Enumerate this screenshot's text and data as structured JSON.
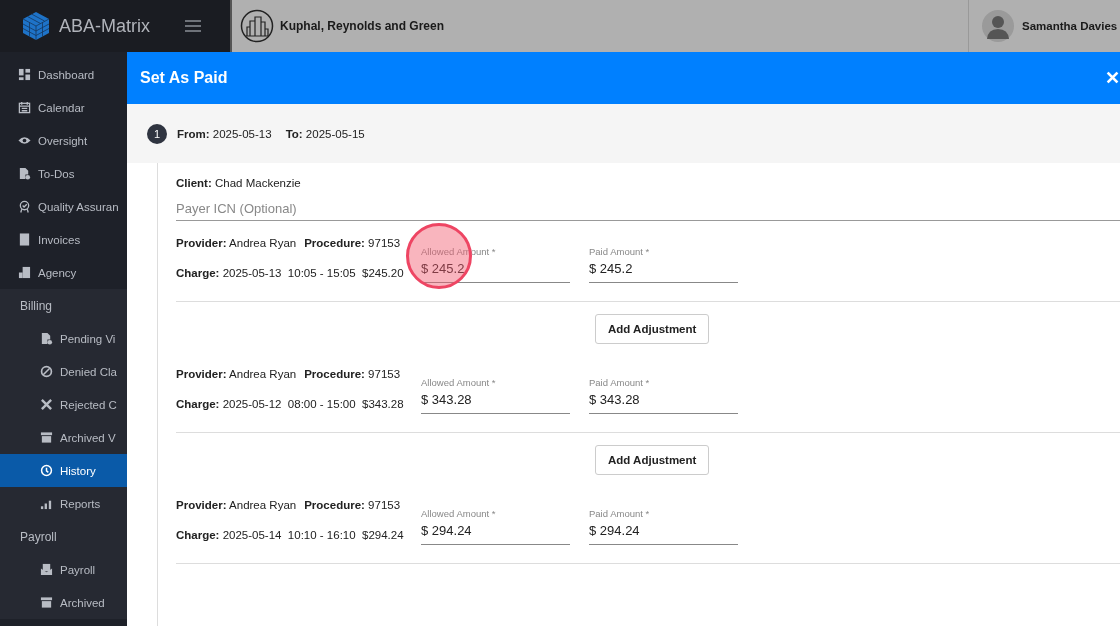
{
  "brand": {
    "name": "ABA-Matrix"
  },
  "header": {
    "company": "Kuphal, Reynolds and Green",
    "user": "Samantha Davies"
  },
  "sidebar": {
    "items": [
      {
        "kind": "item",
        "label": "Dashboard",
        "selected": false
      },
      {
        "kind": "item",
        "label": "Calendar",
        "selected": false
      },
      {
        "kind": "item",
        "label": "Oversight",
        "selected": false
      },
      {
        "kind": "item",
        "label": "To-Dos",
        "selected": false
      },
      {
        "kind": "item",
        "label": "Quality Assuran",
        "selected": false
      },
      {
        "kind": "item",
        "label": "Invoices",
        "selected": false
      },
      {
        "kind": "item",
        "label": "Agency",
        "selected": false
      },
      {
        "kind": "section",
        "label": "Billing"
      },
      {
        "kind": "sub",
        "label": "Pending Vi",
        "selected": false
      },
      {
        "kind": "sub",
        "label": "Denied Cla",
        "selected": false
      },
      {
        "kind": "sub",
        "label": "Rejected C",
        "selected": false
      },
      {
        "kind": "sub",
        "label": "Archived V",
        "selected": false
      },
      {
        "kind": "sub",
        "label": "History",
        "selected": true
      },
      {
        "kind": "sub",
        "label": "Reports",
        "selected": false
      },
      {
        "kind": "section",
        "label": "Payroll"
      },
      {
        "kind": "sub",
        "label": "Payroll",
        "selected": false
      },
      {
        "kind": "sub",
        "label": "Archived",
        "selected": false
      }
    ]
  },
  "modal": {
    "title": "Set As Paid",
    "close": "✕",
    "step": {
      "number": "1",
      "from": "**From:** 2025-05-13",
      "to": "**To:** 2025-05-15"
    },
    "client": "**Client:** Chad Mackenzie",
    "payer_icn": {
      "placeholder": "Payer ICN (Optional)"
    },
    "charges": [
      {
        "provider": "**Provider:** Andrea Ryan",
        "procedure": "**Procedure:** 97153",
        "charge": "**Charge:** 2025-05-13  10:05 - 15:05  $245.20",
        "allowed": {
          "label": "Allowed Amount *",
          "value": "$ 245.2"
        },
        "paid": {
          "label": "Paid Amount *",
          "value": "$ 245.2"
        },
        "clicked": true,
        "button": "Add Adjustment"
      },
      {
        "provider": "**Provider:** Andrea Ryan",
        "procedure": "**Procedure:** 97153",
        "charge": "**Charge:** 2025-05-12  08:00 - 15:00  $343.28",
        "allowed": {
          "label": "Allowed Amount *",
          "value": "$ 343.28"
        },
        "paid": {
          "label": "Paid Amount *",
          "value": "$ 343.28"
        },
        "clicked": false,
        "button": "Add Adjustment"
      },
      {
        "provider": "**Provider:** Andrea Ryan",
        "procedure": "**Procedure:** 97153",
        "charge": "**Charge:** 2025-05-14  10:10 - 16:10  $294.24",
        "allowed": {
          "label": "Allowed Amount *",
          "value": "$ 294.24"
        },
        "paid": {
          "label": "Paid Amount *",
          "value": "$ 294.24"
        },
        "clicked": false
      }
    ]
  }
}
